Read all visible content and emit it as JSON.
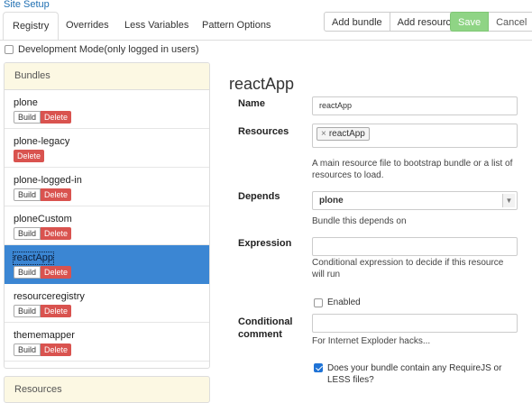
{
  "header": {
    "site_setup": "Site Setup"
  },
  "tabs": [
    {
      "label": "Registry",
      "active": true
    },
    {
      "label": "Overrides",
      "active": false
    },
    {
      "label": "Less Variables",
      "active": false
    },
    {
      "label": "Pattern Options",
      "active": false
    }
  ],
  "toolbar": {
    "add_bundle": "Add bundle",
    "add_resource": "Add resource",
    "save": "Save",
    "cancel": "Cancel"
  },
  "dev_mode": {
    "label": "Development Mode(only logged in users)",
    "checked": false
  },
  "bundles_panel": {
    "title": "Bundles",
    "items": [
      {
        "name": "plone",
        "build": "Build",
        "delete": "Delete"
      },
      {
        "name": "plone-legacy",
        "delete": "Delete"
      },
      {
        "name": "plone-logged-in",
        "build": "Build",
        "delete": "Delete"
      },
      {
        "name": "ploneCustom",
        "build": "Build",
        "delete": "Delete"
      },
      {
        "name": "reactApp",
        "build": "Build",
        "delete": "Delete",
        "selected": true
      },
      {
        "name": "resourceregistry",
        "build": "Build",
        "delete": "Delete"
      },
      {
        "name": "thememapper",
        "build": "Build",
        "delete": "Delete"
      }
    ]
  },
  "resources_panel": {
    "title": "Resources"
  },
  "detail": {
    "title": "reactApp",
    "name": {
      "label": "Name",
      "value": "reactApp"
    },
    "resources": {
      "label": "Resources",
      "token": "reactApp",
      "help": "A main resource file to bootstrap bundle or a list of resources to load."
    },
    "depends": {
      "label": "Depends",
      "value": "plone",
      "help": "Bundle this depends on"
    },
    "expression": {
      "label": "Expression",
      "value": "",
      "help": "Conditional expression to decide if this resource will run"
    },
    "enabled": {
      "label": "Enabled",
      "checked": false
    },
    "conditional_comment": {
      "label": "Conditional comment",
      "value": "",
      "help": "For Internet Exploder hacks..."
    },
    "requirejs": {
      "label": "Does your bundle contain any RequireJS or LESS files?",
      "checked": true
    }
  },
  "colors": {
    "accent": "#3b86d3",
    "save": "#8fd485",
    "delete": "#d9534f",
    "panel_head": "#fcf8e3"
  }
}
